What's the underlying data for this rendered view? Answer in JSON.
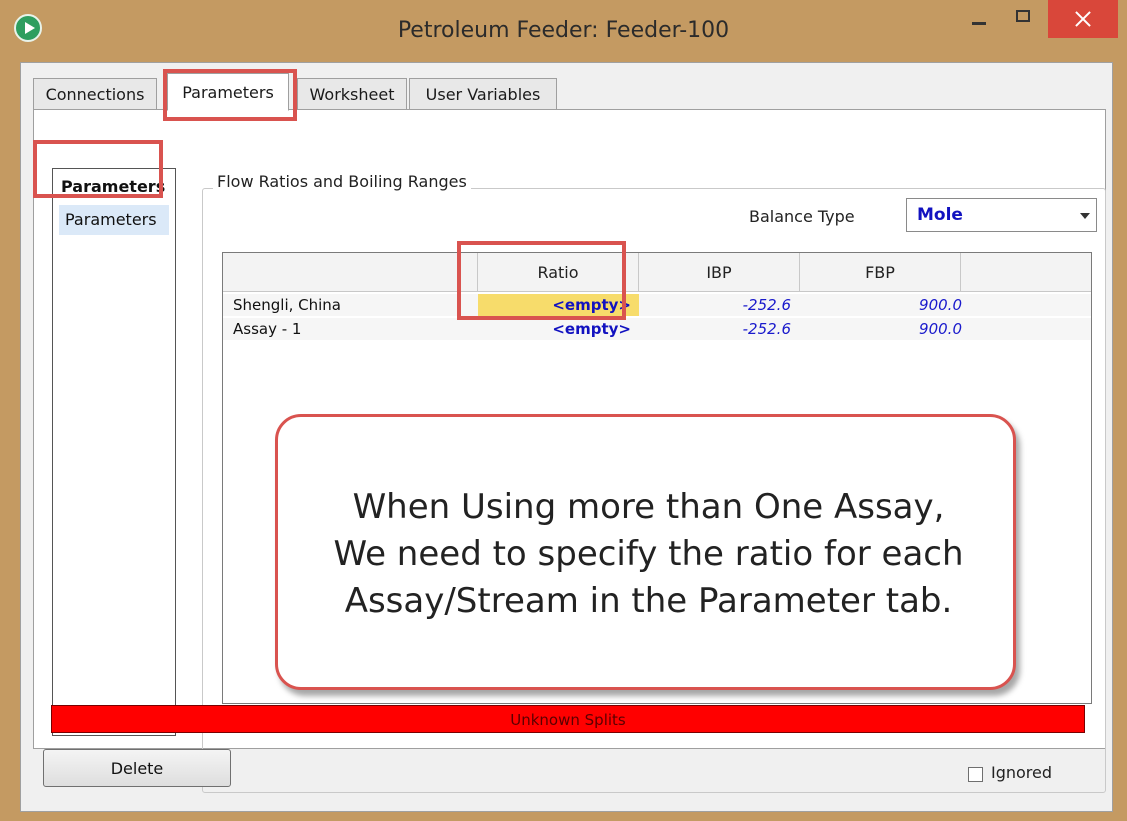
{
  "window": {
    "title": "Petroleum Feeder: Feeder-100"
  },
  "tabs": [
    {
      "label": "Connections"
    },
    {
      "label": "Parameters"
    },
    {
      "label": "Worksheet"
    },
    {
      "label": "User Variables"
    }
  ],
  "nav": {
    "header": "Parameters",
    "items": [
      {
        "label": "Parameters"
      }
    ]
  },
  "group": {
    "label": "Flow Ratios and Boiling Ranges",
    "balance_type_label": "Balance Type",
    "balance_type_value": "Mole"
  },
  "grid": {
    "columns": [
      "",
      "Ratio",
      "IBP",
      "FBP",
      ""
    ],
    "rows": [
      {
        "name": "Shengli, China",
        "ratio": "<empty>",
        "ibp": "-252.6",
        "fbp": "900.0"
      },
      {
        "name": "Assay - 1",
        "ratio": "<empty>",
        "ibp": "-252.6",
        "fbp": "900.0"
      }
    ]
  },
  "callout": {
    "lines": [
      "When Using more than One Assay,",
      "We need to specify the ratio for each",
      "Assay/Stream in the Parameter tab."
    ]
  },
  "status": {
    "text": "Unknown Splits"
  },
  "footer": {
    "delete_label": "Delete",
    "ignored_label": "Ignored"
  },
  "colors": {
    "title_bar": "#c49a62",
    "status_bg": "#ff0000",
    "highlight": "#d9534f",
    "value_text": "#1212c0",
    "selected_cell": "#f7dc6b"
  }
}
